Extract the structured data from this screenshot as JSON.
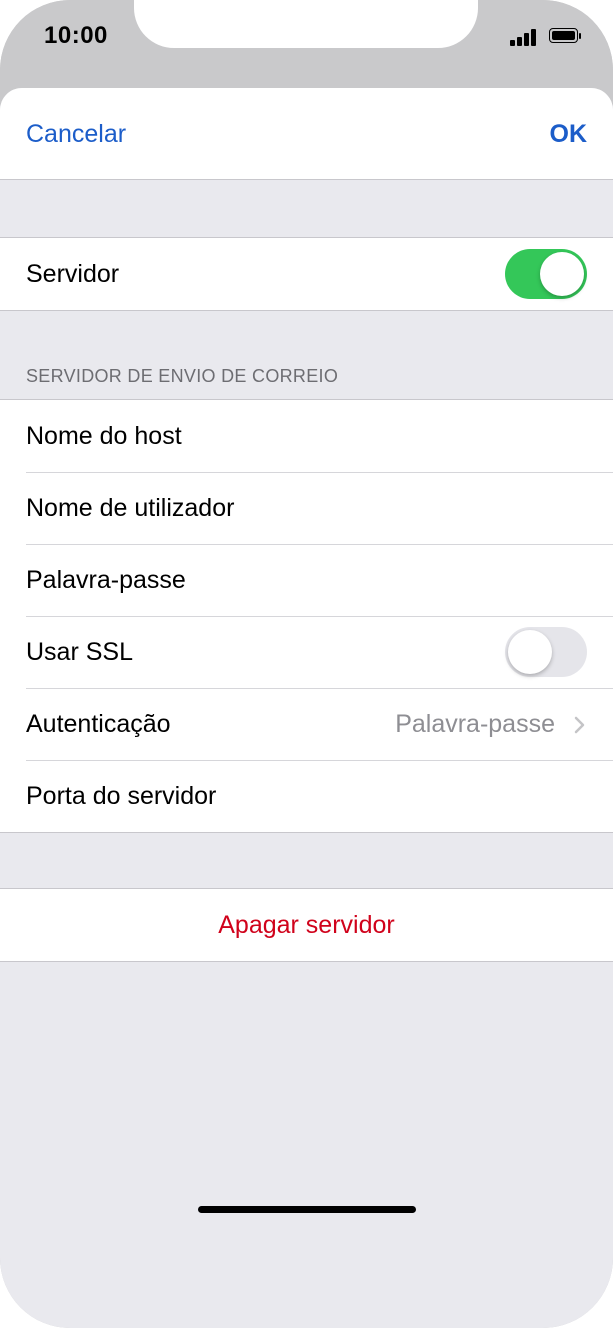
{
  "status_bar": {
    "time": "10:00",
    "icons": [
      "signal-icon",
      "battery-icon"
    ]
  },
  "navbar": {
    "cancel_label": "Cancelar",
    "ok_label": "OK"
  },
  "server_toggle": {
    "label": "Servidor",
    "enabled": true
  },
  "outgoing_section": {
    "header": "SERVIDOR DE ENVIO DE CORREIO",
    "rows": {
      "hostname": {
        "label": "Nome do host",
        "value": ""
      },
      "username": {
        "label": "Nome de utilizador",
        "value": ""
      },
      "password": {
        "label": "Palavra-passe",
        "value": ""
      },
      "use_ssl": {
        "label": "Usar SSL",
        "enabled": false
      },
      "authentication": {
        "label": "Autenticação",
        "value": "Palavra-passe"
      },
      "server_port": {
        "label": "Porta do servidor",
        "value": ""
      }
    }
  },
  "delete_server": {
    "label": "Apagar servidor"
  },
  "colors": {
    "accent": "#1c5dc9",
    "toggle_on": "#34c759",
    "destructive": "#d0021b",
    "grouped_background": "#e9e9ee"
  }
}
